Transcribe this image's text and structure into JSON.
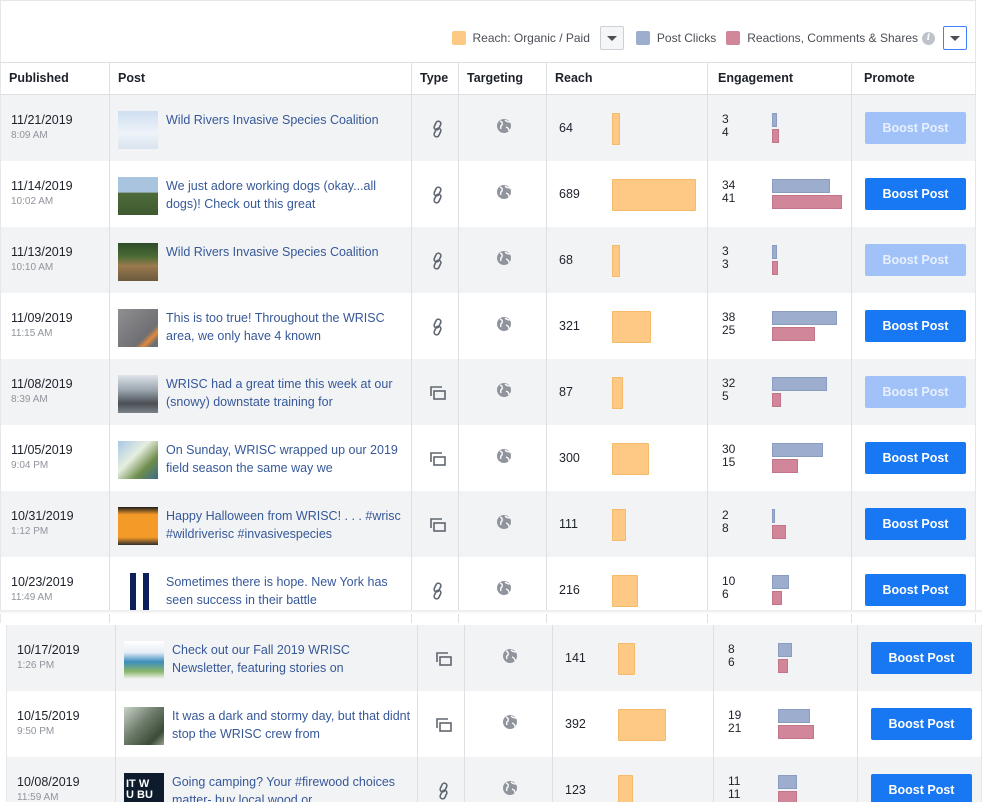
{
  "legend": {
    "reach_label": "Reach: Organic / Paid",
    "clicks_label": "Post Clicks",
    "reactions_label": "Reactions, Comments & Shares",
    "colors": {
      "reach": "#fec984",
      "clicks": "#9cadcd",
      "reactions": "#d1869a",
      "accent": "#1877f2"
    }
  },
  "columns": [
    "Published",
    "Post",
    "Type",
    "Targeting",
    "Reach",
    "Engagement",
    "Promote"
  ],
  "rows": [
    {
      "date": "11/21/2019",
      "time": "8:09 AM",
      "post": "Wild Rivers Invasive Species Coalition",
      "type": "link-icon",
      "reach": "64",
      "clicks": "3",
      "reactions": "4",
      "boost": "Boost Post",
      "boost_enabled": false,
      "thumb": "sky"
    },
    {
      "date": "11/14/2019",
      "time": "10:02 AM",
      "post": "We just adore working dogs (okay...all dogs)! Check out this great",
      "type": "link-icon",
      "reach": "689",
      "clicks": "34",
      "reactions": "41",
      "boost": "Boost Post",
      "boost_enabled": true,
      "thumb": "dog"
    },
    {
      "date": "11/13/2019",
      "time": "10:10 AM",
      "post": "Wild Rivers Invasive Species Coalition",
      "type": "link-icon",
      "reach": "68",
      "clicks": "3",
      "reactions": "3",
      "boost": "Boost Post",
      "boost_enabled": false,
      "thumb": "field"
    },
    {
      "date": "11/09/2019",
      "time": "11:15 AM",
      "post": "This is too true! Throughout the WRISC area, we only have 4 known",
      "type": "link-icon",
      "reach": "321",
      "clicks": "38",
      "reactions": "25",
      "boost": "Boost Post",
      "boost_enabled": true,
      "thumb": "grey"
    },
    {
      "date": "11/08/2019",
      "time": "8:39 AM",
      "post": "WRISC had a great time this week at our (snowy) downstate training for",
      "type": "album-icon",
      "reach": "87",
      "clicks": "32",
      "reactions": "5",
      "boost": "Boost Post",
      "boost_enabled": false,
      "thumb": "snow"
    },
    {
      "date": "11/05/2019",
      "time": "9:04 PM",
      "post": "On Sunday, WRISC wrapped up our 2019 field season the same way we",
      "type": "album-icon",
      "reach": "300",
      "clicks": "30",
      "reactions": "15",
      "boost": "Boost Post",
      "boost_enabled": true,
      "thumb": "crew"
    },
    {
      "date": "10/31/2019",
      "time": "1:12 PM",
      "post": "Happy Halloween from WRISC! . . . #wrisc #wildriverisc #invasivespecies",
      "type": "album-icon",
      "reach": "111",
      "clicks": "2",
      "reactions": "8",
      "boost": "Boost Post",
      "boost_enabled": true,
      "thumb": "orange"
    },
    {
      "date": "10/23/2019",
      "time": "11:49 AM",
      "post": "Sometimes there is hope. New York has seen success in their battle",
      "type": "link-icon",
      "reach": "216",
      "clicks": "10",
      "reactions": "6",
      "boost": "Boost Post",
      "boost_enabled": true,
      "thumb": "letters"
    },
    {
      "date": "10/17/2019",
      "time": "1:26 PM",
      "post": "Check out our Fall 2019 WRISC Newsletter, featuring stories on",
      "type": "album-icon",
      "reach": "141",
      "clicks": "8",
      "reactions": "6",
      "boost": "Boost Post",
      "boost_enabled": true,
      "thumb": "newsletter"
    },
    {
      "date": "10/15/2019",
      "time": "9:50 PM",
      "post": "It was a dark and stormy day, but that didnt stop the WRISC crew from",
      "type": "album-icon",
      "reach": "392",
      "clicks": "19",
      "reactions": "21",
      "boost": "Boost Post",
      "boost_enabled": true,
      "thumb": "forest"
    },
    {
      "date": "10/08/2019",
      "time": "11:59 AM",
      "post": "Going camping? Your #firewood choices matter- buy local wood or",
      "type": "link-icon",
      "reach": "123",
      "clicks": "11",
      "reactions": "11",
      "boost": "Boost Post",
      "boost_enabled": true,
      "thumb": "camping",
      "thumb_text": "IT W\nU BU"
    }
  ]
}
